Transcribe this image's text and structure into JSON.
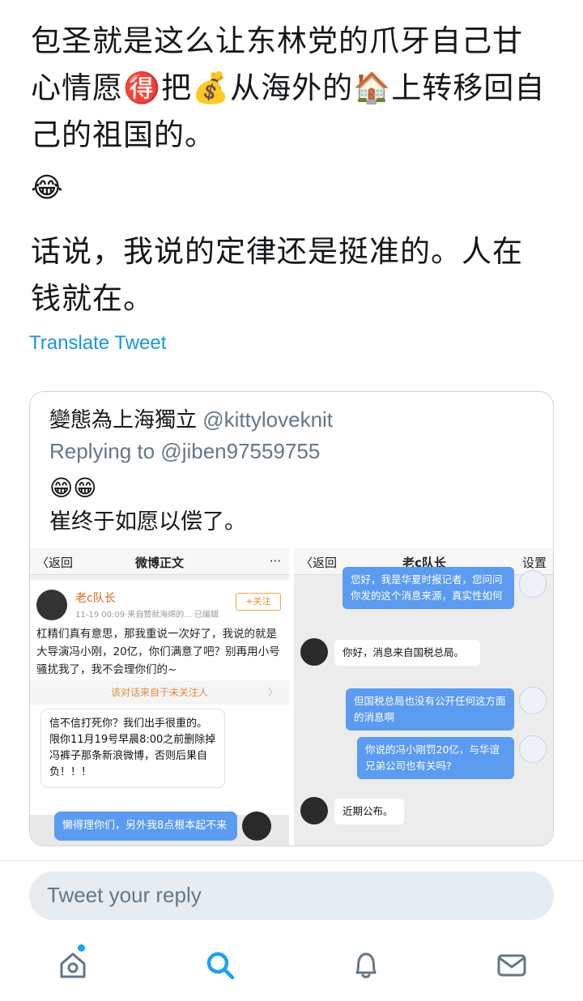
{
  "tweet": {
    "text_lines": [
      "包圣就是这么让东林党的爪牙自己甘",
      "心情愿🉐把💰从海外的🏠上转移回自",
      "己的祖国的。"
    ],
    "emoji_line": "😂",
    "text2_lines": [
      "话说，我说的定律还是挺准的。人在",
      "钱就在。"
    ],
    "translate_label": "Translate Tweet"
  },
  "quote": {
    "name": "變態為上海獨立",
    "handle": "@kittyloveknit",
    "replying_to": "Replying to @jiben97559755",
    "emoji": "😁😁",
    "text": "崔终于如愿以偿了。",
    "left_shot": {
      "back": "〈返回",
      "title": "微博正文",
      "more": "···",
      "user": "老c队长",
      "meta": "11-19 00:09  来自赞就海绵的...  已编辑",
      "follow": "+关注",
      "body": "杠精们真有意思，那我重说一次好了，我说的就是大导演冯小刚，20亿，你们满意了吧？别再用小号骚扰我了，我不会理你们的~",
      "note": "该对话来自于未关注人",
      "note_chevron": "〉",
      "bubble": "信不信打死你？我们出手很重的。限你11月19号早晨8:00之前删除掉冯裤子那条新浪微博，否则后果自负！！！",
      "sent": "懒得理你们，另外我8点根本起不来"
    },
    "right_shot": {
      "back": "〈返回",
      "title": "老c队长",
      "settings": "设置",
      "msg1": "您好，我是华夏时报记者，您问问你发的这个消息来源，真实性如何",
      "msg2": "你好，消息来自国税总局。",
      "msg3": "但国税总局也没有公开任何这方面的消息啊",
      "msg4": "你说的冯小刚罚20亿，与华谊兄弟公司也有关吗?",
      "msg5": "近期公布。"
    }
  },
  "reply": {
    "placeholder": "Tweet your reply"
  },
  "tabbar": {
    "items": [
      "home-icon",
      "search-icon",
      "bell-icon",
      "mail-icon"
    ],
    "active_color": "#1da1f2",
    "inactive_color": "#657786"
  }
}
